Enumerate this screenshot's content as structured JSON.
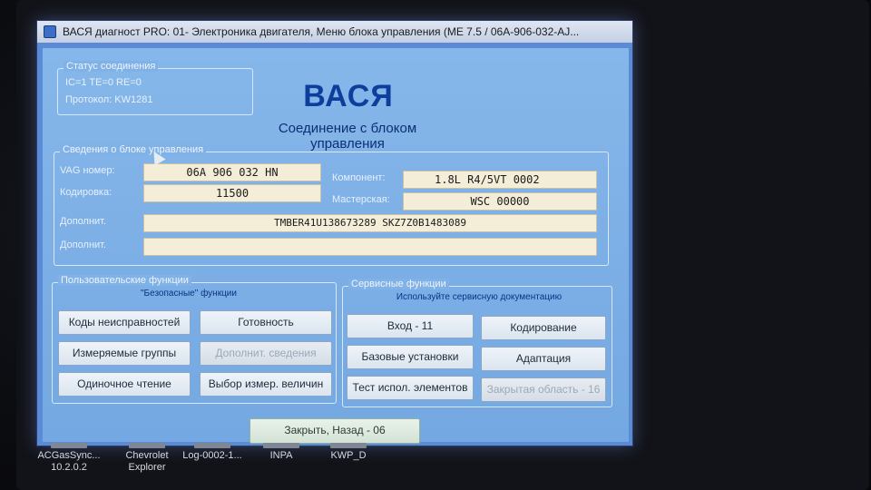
{
  "window": {
    "title": "ВАСЯ диагност PRO: 01- Электроника двигателя,  Меню блока управления (ME 7.5 / 06A-906-032-AJ..."
  },
  "status": {
    "group_title": "Статус соединения",
    "line1": "IC=1  TE=0  RE=0",
    "line2": "Протокол: KW1281"
  },
  "brand": "ВАСЯ",
  "connection_text": "Соединение с блоком управления",
  "ecu_info": {
    "group_title": "Сведения о блоке управления",
    "vag_label": "VAG номер:",
    "vag_value": "06A 906 032 HN",
    "coding_label": "Кодировка:",
    "coding_value": "11500",
    "component_label": "Компонент:",
    "component_value": "1.8L R4/5VT        0002",
    "workshop_label": "Мастерская:",
    "workshop_value": "WSC 00000",
    "extra1_label": "Дополнит.",
    "extra1_value": "TMBER41U138673289   SKZ7Z0B1483089",
    "extra2_label": "Дополнит.",
    "extra2_value": ""
  },
  "user_functions": {
    "group_title": "Пользовательские функции",
    "subtitle": "\"Безопасные\" функции",
    "buttons": [
      "Коды неисправностей",
      "Готовность",
      "Измеряемые группы",
      "Дополнит. сведения",
      "Одиночное чтение",
      "Выбор измер. величин"
    ]
  },
  "service_functions": {
    "group_title": "Сервисные функции",
    "subtitle": "Используйте сервисную документацию",
    "buttons": [
      "Вход - 11",
      "Кодирование",
      "Базовые установки",
      "Адаптация",
      "Тест испол. элементов",
      "Закрытая область - 16"
    ]
  },
  "close_button": "Закрыть, Назад - 06",
  "desktop_icons": [
    {
      "line1": "ACGasSync...",
      "line2": "10.2.0.2"
    },
    {
      "line1": "Chevrolet",
      "line2": "Explorer"
    },
    {
      "line1": "Log-0002-1...",
      "line2": ""
    },
    {
      "line1": "INPA",
      "line2": ""
    },
    {
      "line1": "KWP_D",
      "line2": ""
    }
  ]
}
